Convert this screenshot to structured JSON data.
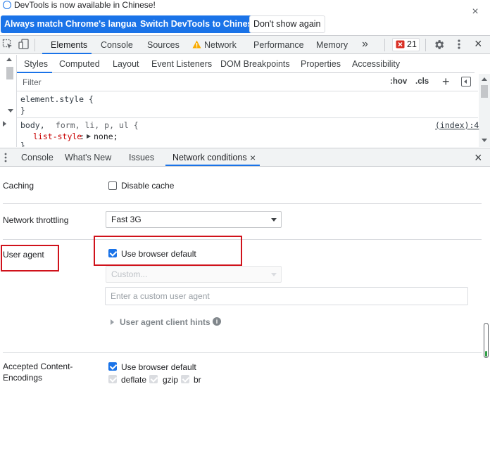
{
  "infobar": {
    "message": "DevTools is now available in Chinese!",
    "btn_match": "Always match Chrome's language",
    "btn_switch": "Switch DevTools to Chinese",
    "btn_dismiss": "Don't show again",
    "close": "×"
  },
  "main_tabs": {
    "elements": "Elements",
    "console": "Console",
    "sources": "Sources",
    "network": "Network",
    "performance": "Performance",
    "memory": "Memory",
    "more": "»",
    "error_count": "21",
    "close": "×"
  },
  "style_tabs": {
    "styles": "Styles",
    "computed": "Computed",
    "layout": "Layout",
    "event_listeners": "Event Listeners",
    "dom_breakpoints": "DOM Breakpoints",
    "properties": "Properties",
    "accessibility": "Accessibility"
  },
  "filter": {
    "placeholder": "Filter",
    "hov": ":hov",
    "cls": ".cls",
    "plus": "+"
  },
  "code": {
    "element_style": "element.style {",
    "close_brace": "}",
    "selector_body": "body,",
    "selector_rest": " form, li, p, ul {",
    "source_link": "(index):4",
    "prop_name": "list-style",
    "prop_sep": ":",
    "prop_arrow": "▶",
    "prop_value": "none;",
    "partial_brace": "}"
  },
  "drawer_tabs": {
    "console": "Console",
    "whats_new": "What's New",
    "issues": "Issues",
    "network_conditions": "Network conditions",
    "tab_close": "×",
    "close": "×"
  },
  "network_conditions": {
    "caching_label": "Caching",
    "disable_cache_label": "Disable cache",
    "throttling_label": "Network throttling",
    "throttling_value": "Fast 3G",
    "user_agent_label": "User agent",
    "use_browser_default": "Use browser default",
    "custom_select": "Custom...",
    "custom_placeholder": "Enter a custom user agent",
    "client_hints": "User agent client hints",
    "encodings_label_line1": "Accepted Content-",
    "encodings_label_line2": "Encodings",
    "encodings_default": "Use browser default",
    "enc_deflate": "deflate",
    "enc_gzip": "gzip",
    "enc_br": "br"
  },
  "colors": {
    "accent": "#1a73e8",
    "annotation_red": "#d0121b",
    "error_red": "#d93025"
  }
}
